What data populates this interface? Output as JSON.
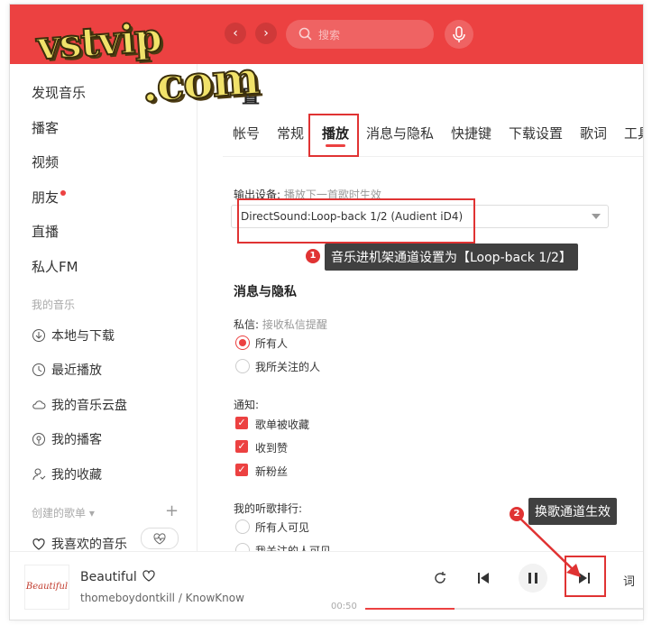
{
  "watermark": {
    "line1": "vstvip",
    "line2": ".com"
  },
  "header": {
    "back_icon": "‹",
    "forward_icon": "›",
    "search_placeholder": "搜索",
    "mic_icon": "microphone-icon"
  },
  "sidebar": {
    "items": [
      {
        "label": "发现音乐"
      },
      {
        "label": "播客"
      },
      {
        "label": "视频"
      },
      {
        "label": "朋友"
      },
      {
        "label": "直播"
      },
      {
        "label": "私人FM"
      }
    ],
    "my_music_title": "我的音乐",
    "my_music": [
      {
        "label": "本地与下载",
        "icon": "download-icon"
      },
      {
        "label": "最近播放",
        "icon": "clock-icon"
      },
      {
        "label": "我的音乐云盘",
        "icon": "cloud-icon"
      },
      {
        "label": "我的播客",
        "icon": "podcast-icon"
      },
      {
        "label": "我的收藏",
        "icon": "person-icon"
      }
    ],
    "created_title": "创建的歌单",
    "created_arrow": "▾",
    "plus": "+",
    "liked": "我喜欢的音乐"
  },
  "main": {
    "title": "置",
    "tabs": [
      "帐号",
      "常规",
      "播放",
      "消息与隐私",
      "快捷键",
      "下载设置",
      "歌词",
      "工具"
    ],
    "active_tab": "播放",
    "output_label": "输出设备:",
    "output_hint": "播放下一首歌时生效",
    "output_value": "DirectSound:Loop-back 1/2 (Audient iD4)",
    "privacy_title": "消息与隐私",
    "private_msg_label": "私信:",
    "private_msg_hint": "接收私信提醒",
    "private_msg_options": [
      "所有人",
      "我所关注的人"
    ],
    "private_msg_selected": 0,
    "notify_label": "通知:",
    "notify_options": [
      "歌单被收藏",
      "收到赞",
      "新粉丝"
    ],
    "rank_label": "我的听歌排行:",
    "rank_options": [
      "所有人可见",
      "我关注的人可见"
    ]
  },
  "annotations": {
    "badge1": "1",
    "tip1": "音乐进机架通道设置为【Loop-back 1/2】",
    "badge2": "2",
    "tip2": "换歌通道生效"
  },
  "player": {
    "cover_text": "Beautiful",
    "song": "Beautiful",
    "artist": "thomeboydontkill / KnowKnow",
    "time": "00:50",
    "progress": 0.32,
    "lyric_label": "词",
    "colors": {
      "accent": "#ec4141",
      "annotation": "#e03333"
    }
  }
}
